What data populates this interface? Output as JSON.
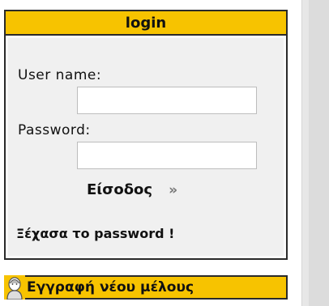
{
  "login": {
    "title": "login",
    "username_label": "User name:",
    "username_value": "",
    "password_label": "Password:",
    "password_value": "",
    "submit_label": "Είσοδος",
    "submit_arrow": "»",
    "forgot_label": "Ξέχασα το password !"
  },
  "register": {
    "label": "Εγγραφή νέου μέλους",
    "icon": "user-head-icon"
  },
  "colors": {
    "header_bg": "#f7c300",
    "box_bg": "#f0f0f0",
    "border": "#2a2a2a"
  }
}
